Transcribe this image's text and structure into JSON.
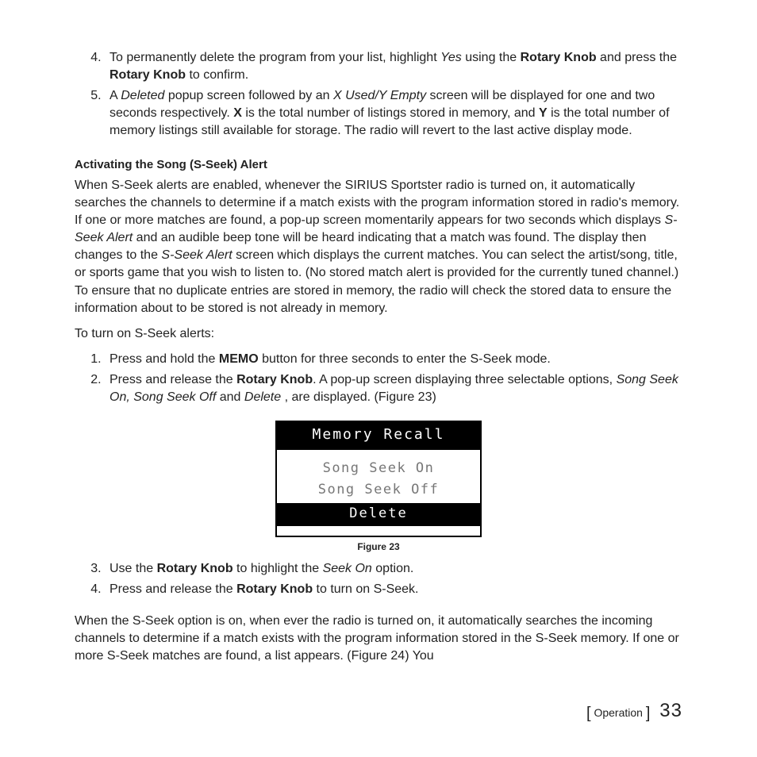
{
  "list1": {
    "start": 4,
    "items": [
      {
        "pre": "To permanently delete the program from your list, highlight ",
        "i1": "Yes",
        "mid1": " using the ",
        "b1": "Rotary Knob",
        "mid2": " and press the ",
        "b2": "Rotary Knob",
        "post": " to confirm."
      },
      {
        "pre": "A ",
        "i1": "Deleted",
        "mid1": " popup screen followed by an ",
        "i2": "X Used/Y Empty",
        "mid2": " screen will be displayed for one and two seconds respectively. ",
        "b1": "X",
        "mid3": " is the total number of listings stored in memory, and ",
        "b2": "Y",
        "post": " is the total number of memory listings still available for storage. The radio will revert to the last active display mode."
      }
    ]
  },
  "heading": "Activating the Song (S-Seek) Alert",
  "para1": {
    "t1": "When S-Seek alerts are enabled, whenever the SIRIUS Sportster radio is turned on, it automatically searches the channels to determine if a match exists with the program information stored in radio's memory. If one or more matches are found, a pop-up screen momentarily appears for two seconds which displays ",
    "i1": "S-Seek Alert",
    "t2": " and an audible beep tone will be heard indicating that a match was found. The display then changes to the ",
    "i2": "S-Seek Alert",
    "t3": " screen which displays the current matches. You can select the artist/song, title, or sports game that you wish to listen to. (No stored match alert is provided for the currently tuned channel.) To ensure that no duplicate entries are stored in memory, the radio will check the stored data to ensure the information about to be stored is not already in memory."
  },
  "para2": "To turn on S-Seek alerts:",
  "list2": {
    "start": 1,
    "items": [
      {
        "pre": "Press and hold the ",
        "b1": "MEMO",
        "post": " button for three seconds to enter the S-Seek mode."
      },
      {
        "pre": "Press and release the ",
        "b1": "Rotary Knob",
        "mid1": ". A pop-up screen displaying three selectable options, ",
        "i1": "Song Seek On, Song Seek Off",
        "mid2": " and ",
        "i2": "Delete",
        "post": " , are displayed. (Figure 23)"
      }
    ]
  },
  "lcd": {
    "title": "Memory Recall",
    "opt1": "Song Seek On",
    "opt2": "Song Seek Off",
    "opt3": "Delete"
  },
  "figcap": "Figure 23",
  "list3": {
    "start": 3,
    "items": [
      {
        "pre": "Use the ",
        "b1": "Rotary Knob",
        "mid1": " to highlight the ",
        "i1": "Seek On",
        "post": " option."
      },
      {
        "pre": "Press and release the ",
        "b1": "Rotary Knob",
        "post": " to turn on S-Seek."
      }
    ]
  },
  "para3": "When the S-Seek option is on, when ever the radio is turned on, it automatically searches the incoming channels to determine if a match exists with the program information stored in the S-Seek memory. If one or more S-Seek matches are found, a list appears. (Figure 24) You",
  "footer": {
    "section": "Operation",
    "page": "33"
  }
}
